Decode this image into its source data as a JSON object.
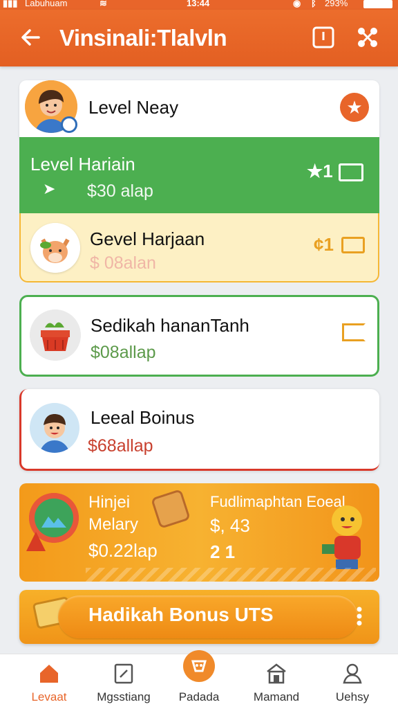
{
  "status": {
    "carrier": "Labuhuam",
    "time": "13:44",
    "battery": "293%"
  },
  "header": {
    "title": "Vinsinali:Tlalvln"
  },
  "cards": [
    {
      "title": "Level Neay"
    },
    {
      "title": "Level Hariain",
      "price": "$30 alap",
      "badge": "★1"
    },
    {
      "title": "Gevel Harjaan",
      "price": "$ 08alan",
      "badge": "¢1"
    },
    {
      "title": "Sedikah hananTanh",
      "price": "$08allap"
    },
    {
      "title": "Leeal Boinus",
      "price": "$68allap"
    }
  ],
  "promo": {
    "left": {
      "line1": "Hinjei",
      "line2": "Melary",
      "line3": "$0.22lap"
    },
    "right": {
      "line1": "Fudlimaphtan Eoeal",
      "line2": "$, 43",
      "line3": "2 1"
    }
  },
  "bonus_button": {
    "label": "Hadikah Bonus UTS"
  },
  "nav": {
    "items": [
      {
        "label": "Levaat"
      },
      {
        "label": "Mgsstiang"
      },
      {
        "label": "Padada"
      },
      {
        "label": "Mamand"
      },
      {
        "label": "Uehsy"
      }
    ]
  },
  "colors": {
    "accent": "#e8652a",
    "green": "#4caf50",
    "yellow": "#f6a623",
    "orange_card": "#f59a1e"
  }
}
